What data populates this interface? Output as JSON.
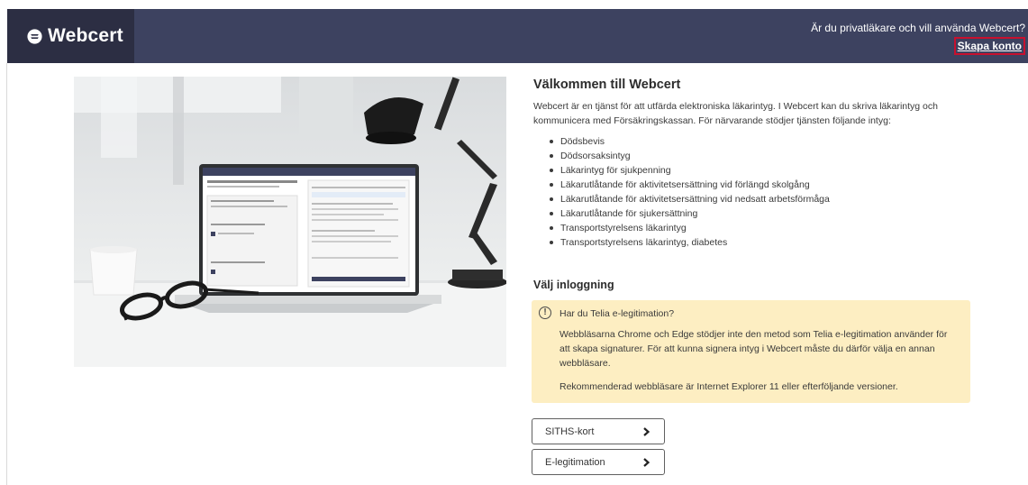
{
  "header": {
    "logo_text": "Webcert",
    "question": "Är du privatläkare och vill använda Webcert?",
    "create_account": "Skapa konto"
  },
  "welcome": {
    "title": "Välkommen till Webcert",
    "intro": "Webcert är en tjänst för att utfärda elektroniska läkarintyg. I Webcert kan du skriva läkarintyg och kommunicera med Försäkringskassan. För närvarande stödjer tjänsten följande intyg:",
    "certificates": [
      "Dödsbevis",
      "Dödsorsaksintyg",
      "Läkarintyg för sjukpenning",
      "Läkarutlåtande för aktivitetsersättning vid förlängd skolgång",
      "Läkarutlåtande för aktivitetsersättning vid nedsatt arbetsförmåga",
      "Läkarutlåtande för sjukersättning",
      "Transportstyrelsens läkarintyg",
      "Transportstyrelsens läkarintyg, diabetes"
    ]
  },
  "login": {
    "title": "Välj inloggning",
    "alert": {
      "heading": "Har du Telia e-legitimation?",
      "body": "Webbläsarna Chrome och Edge stödjer inte den metod som Telia e-legitimation använder för att skapa signaturer. För att kunna signera intyg i Webcert måste du därför välja en annan webbläsare.",
      "recommendation": "Rekommenderad webbläsare är Internet Explorer 11 eller efterföljande versioner."
    },
    "buttons": {
      "siths": "SITHS-kort",
      "elegitimation": "E-legitimation"
    }
  },
  "colors": {
    "header_bg": "#3d4260",
    "logo_bg": "#2c2e43",
    "alert_bg": "#fdeec2",
    "focus_outline": "#c8102e"
  },
  "icons": {
    "logo": "webcert-logo-icon",
    "alert": "exclamation-circle-icon",
    "button_arrow": "chevron-right-icon"
  }
}
